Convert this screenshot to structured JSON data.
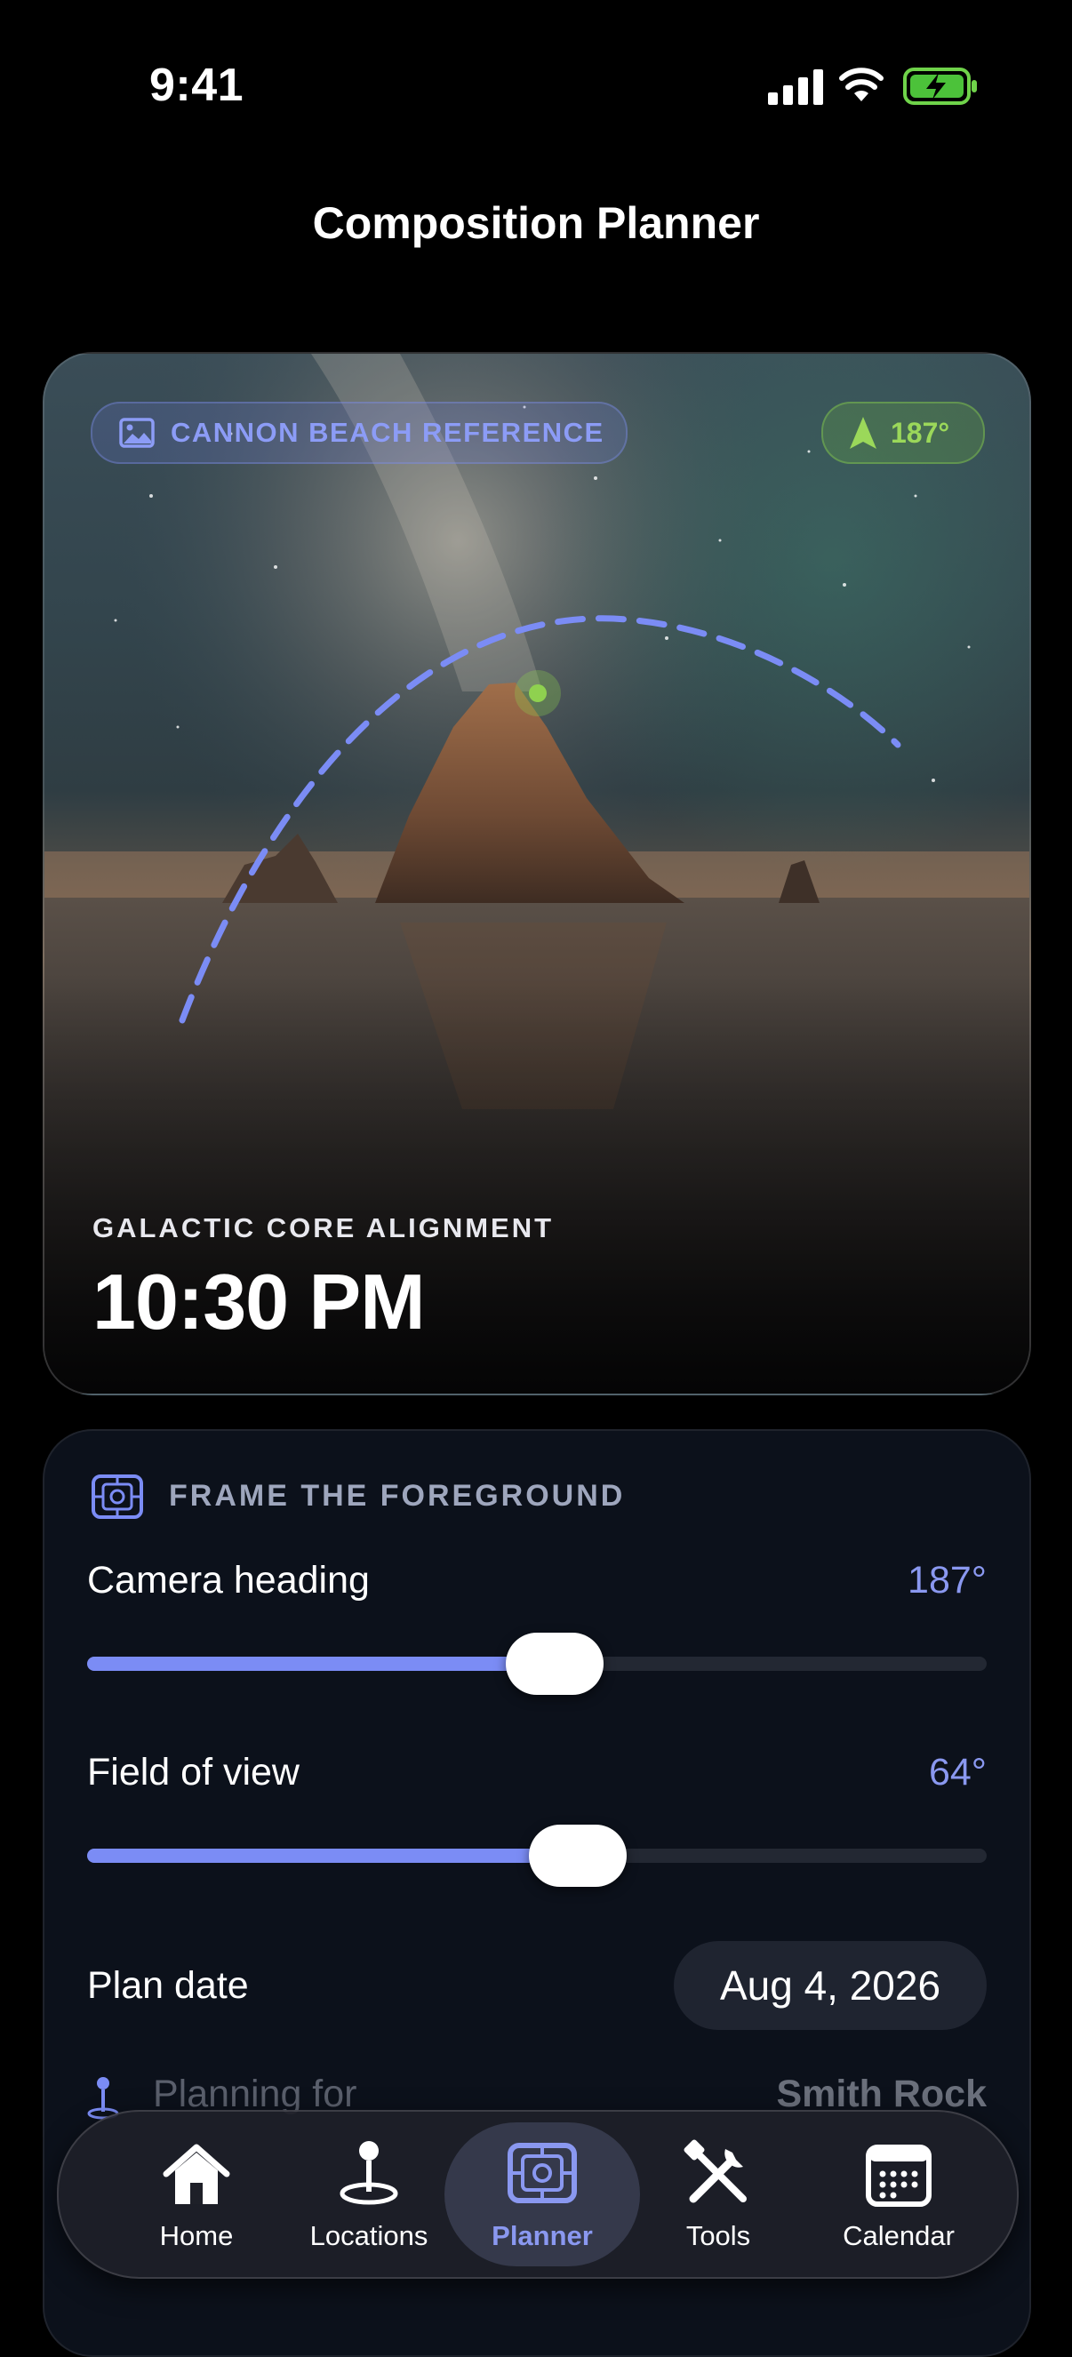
{
  "status": {
    "time": "9:41"
  },
  "header": {
    "title": "Composition Planner"
  },
  "hero": {
    "reference_label": "CANNON BEACH REFERENCE",
    "heading_badge": "187°",
    "alignment_label": "GALACTIC CORE ALIGNMENT",
    "alignment_time": "10:30 PM"
  },
  "controls": {
    "section_title": "FRAME THE FOREGROUND",
    "camera_heading": {
      "label": "Camera heading",
      "value": "187°",
      "fraction": 0.52
    },
    "field_of_view": {
      "label": "Field of view",
      "value": "64°",
      "fraction": 0.545
    },
    "plan_date": {
      "label": "Plan date",
      "value": "Aug 4, 2026"
    },
    "planning_for": {
      "label": "Planning for",
      "value": "Smith Rock"
    }
  },
  "tabbar": {
    "items": [
      {
        "label": "Home",
        "icon": "house-icon"
      },
      {
        "label": "Locations",
        "icon": "location-pin-icon"
      },
      {
        "label": "Planner",
        "icon": "viewfinder-icon",
        "active": true
      },
      {
        "label": "Tools",
        "icon": "tools-icon"
      },
      {
        "label": "Calendar",
        "icon": "calendar-icon"
      }
    ]
  },
  "colors": {
    "accent": "#7b8cf5",
    "green": "#8fd14f",
    "background": "#000000",
    "card": "#0c111b"
  }
}
